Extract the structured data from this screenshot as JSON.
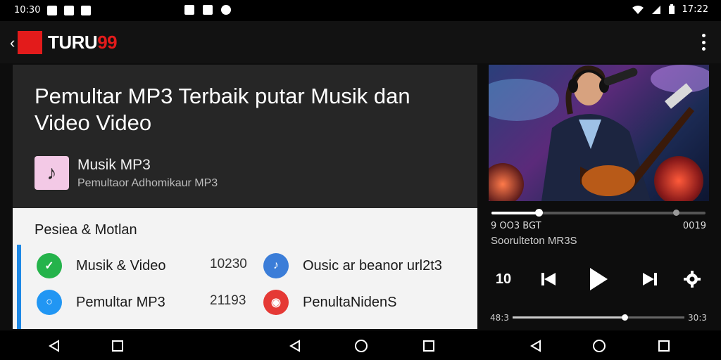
{
  "status_bar": {
    "time_left": "10:30",
    "time_right": "17:22",
    "icons": [
      "gallery-icon",
      "mail-icon",
      "download-icon",
      "notification-icon",
      "shield-icon",
      "sync-icon",
      "wifi-icon",
      "signal-icon",
      "battery-icon"
    ]
  },
  "app_bar": {
    "brand_part1": "TURU",
    "brand_part2": "99",
    "brand_color": "#e31b1b",
    "back_icon": "back-arrow-icon",
    "menu_icon": "more-vert-icon"
  },
  "hero": {
    "title": "Pemultar MP3 Terbaik putar Musik dan Video Video",
    "app_icon": "music-note-icon",
    "app_name": "Musik MP3",
    "app_subtitle": "Pemultaor Adhomikaur MP3"
  },
  "list": {
    "heading": "Pesiea & Motlan",
    "items": [
      {
        "label": "Musik & Video",
        "count": "10230",
        "icon": "chat-icon",
        "color": "#25b34b"
      },
      {
        "label": "Pemultar MP3",
        "count": "21193",
        "icon": "chat-bubble-icon",
        "color": "#2196f3"
      }
    ],
    "side_items": [
      {
        "label": "Ousic ar beanor url2t3",
        "icon": "music-share-icon",
        "color": "#3b7dd8"
      },
      {
        "label": "PenultaNidenS",
        "icon": "record-icon",
        "color": "#e53935"
      }
    ]
  },
  "player": {
    "progress": 0.22,
    "time_elapsed": "9 OO3 BGT",
    "time_total": "0019",
    "track_name": "Soorulteton MR3S",
    "controls": [
      "replay-icon",
      "skip-previous-icon",
      "play-icon",
      "skip-next-icon",
      "settings-icon"
    ],
    "replay_label": "10",
    "second_progress": 0.65,
    "second_elapsed": "48:3",
    "second_total": "30:3"
  },
  "nav_bar": {
    "buttons": [
      "back-icon",
      "home-icon",
      "recents-icon",
      "back-icon",
      "home-icon",
      "recents-icon",
      "back-icon",
      "home-icon",
      "recents-icon"
    ]
  }
}
